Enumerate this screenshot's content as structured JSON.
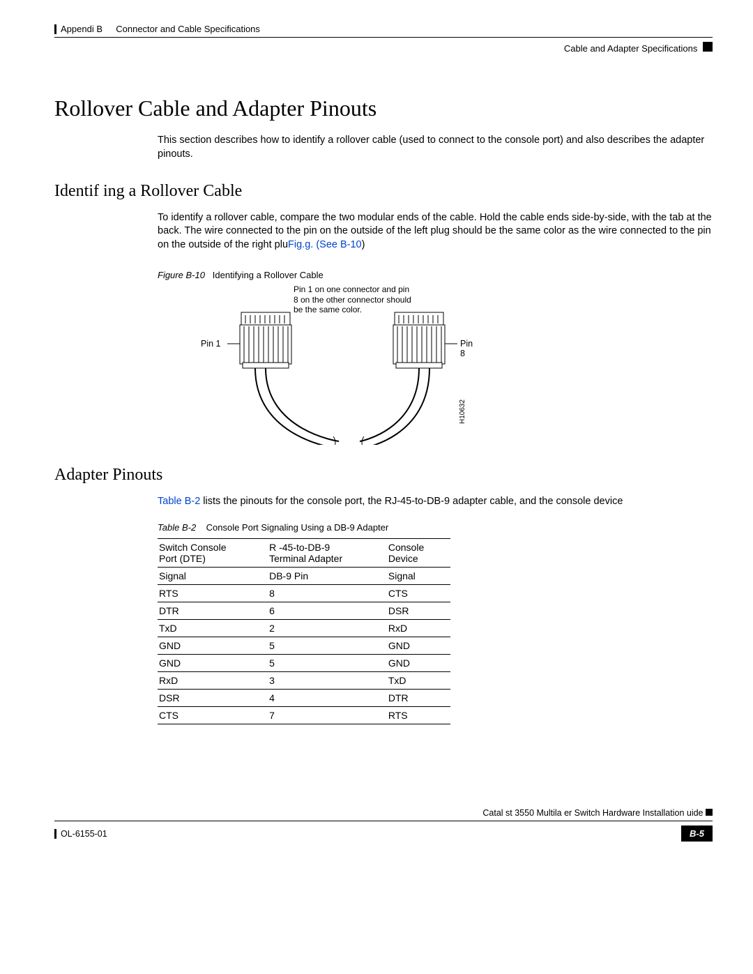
{
  "header": {
    "appendix": "Appendi  B",
    "appendix_title": "Connector and Cable Specifications",
    "section_right": "Cable and Adapter Specifications"
  },
  "title": "Rollover Cable and Adapter Pinouts",
  "intro": "This section describes how to identify a rollover cable (used to connect to the console port) and also describes the adapter pinouts.",
  "identify": {
    "heading": "Identif  ing a Rollover Cable",
    "para_a": "To identify a rollover cable, compare the two modular ends of the cable. Hold the cable ends side-by-side, with the tab at the back. The wire connected to the pin on the outside of the left plug should be the same color as the wire connected to the pin on the outside of the right plu",
    "para_xref": "Fig.g. (See B-10",
    "para_b": ")"
  },
  "figure": {
    "caption_num": "Figure B-10",
    "caption_title": "Identifying a Rollover Cable",
    "note": "Pin 1 on one connector and pin 8 on the other connector should be the same color.",
    "pin1": "Pin 1",
    "pin8": "Pin 8",
    "art_id": "H10632"
  },
  "adapter": {
    "heading": "Adapter Pinouts",
    "para_xref": "Table B-2",
    "para": " lists the pinouts for the console port, the RJ-45-to-DB-9 adapter cable, and the console device"
  },
  "table": {
    "caption_num": "Table B-2",
    "caption_title": "Console Port Signaling Using a DB-9 Adapter",
    "headers": {
      "c1a": "Switch Console",
      "c1b": "Port (DTE)",
      "c2a": "R  -45-to-DB-9",
      "c2b": "Terminal Adapter",
      "c3a": "Console",
      "c3b": "Device"
    },
    "subhead": {
      "c1": "Signal",
      "c2": "DB-9 Pin",
      "c3": "Signal"
    },
    "rows": [
      {
        "c1": "RTS",
        "c2": "8",
        "c3": "CTS"
      },
      {
        "c1": "DTR",
        "c2": "6",
        "c3": "DSR"
      },
      {
        "c1": "TxD",
        "c2": "2",
        "c3": "RxD"
      },
      {
        "c1": "GND",
        "c2": "5",
        "c3": "GND"
      },
      {
        "c1": "GND",
        "c2": "5",
        "c3": "GND"
      },
      {
        "c1": "RxD",
        "c2": "3",
        "c3": "TxD"
      },
      {
        "c1": "DSR",
        "c2": "4",
        "c3": "DTR"
      },
      {
        "c1": "CTS",
        "c2": "7",
        "c3": "RTS"
      }
    ]
  },
  "footer": {
    "book": "Catal  st 3550 Multila  er Switch Hardware Installation   uide",
    "docnum": " OL-6155-01",
    "pagenum": "B-5"
  }
}
